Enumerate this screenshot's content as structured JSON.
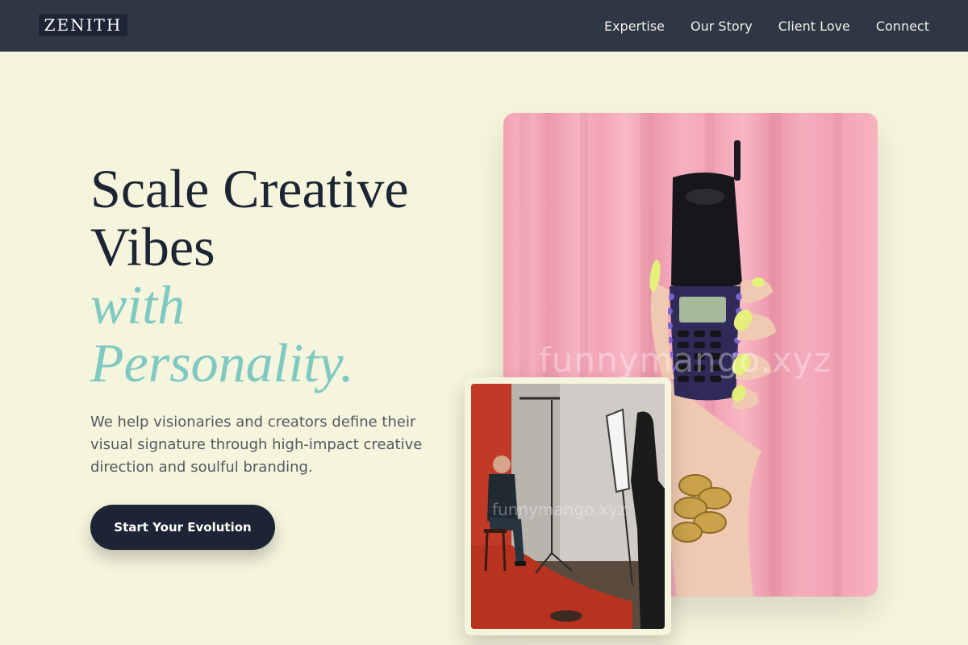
{
  "nav": {
    "logo": "ZENITH",
    "links": [
      "Expertise",
      "Our Story",
      "Client Love",
      "Connect"
    ]
  },
  "hero": {
    "headline_line1": "Scale Creative",
    "headline_line2": "Vibes",
    "headline_accent_line1": "with",
    "headline_accent_line2": "Personality.",
    "subtext": "We help visionaries and creators define their visual signature through high-impact creative direction and soulful branding.",
    "cta_label": "Start Your Evolution"
  },
  "images": {
    "main_watermark": "funnymango.xyz",
    "secondary_watermark": "funnymango.xyz"
  },
  "colors": {
    "nav_bg": "#2e3744",
    "page_bg": "#f5f4dc",
    "ink": "#1d2433",
    "accent": "#7ec9c1",
    "curtain_pink": "#f4a9ba"
  }
}
